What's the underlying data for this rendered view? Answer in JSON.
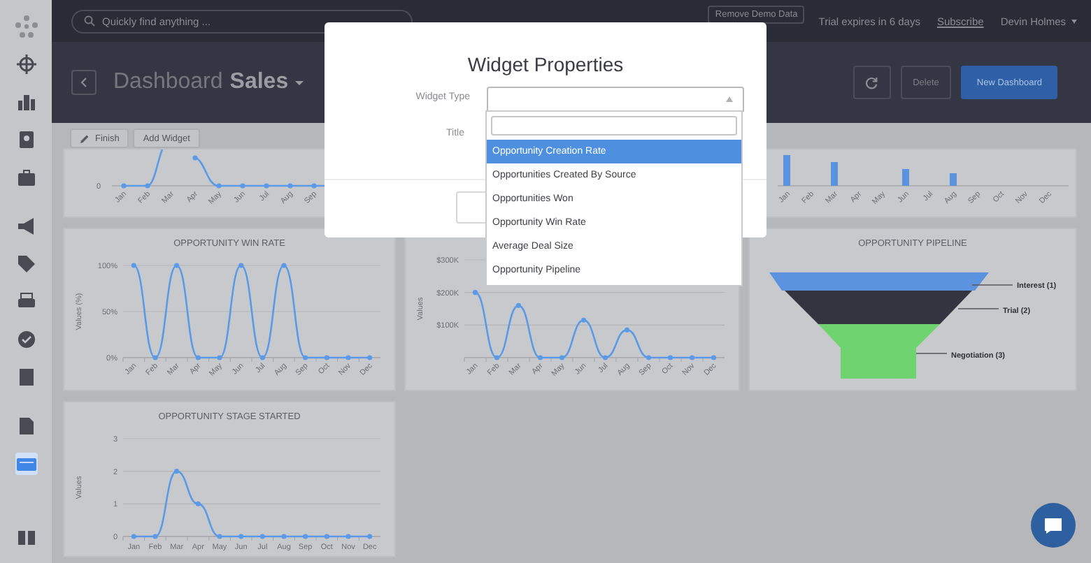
{
  "sidebar": {
    "items": [
      {
        "selected": false
      },
      {
        "selected": false
      },
      {
        "selected": false
      },
      {
        "selected": false
      },
      {
        "selected": false
      },
      {
        "selected": false
      },
      {
        "selected": false
      },
      {
        "selected": false
      },
      {
        "selected": false
      },
      {
        "selected": false
      },
      {
        "selected": true
      },
      {
        "selected": false
      }
    ]
  },
  "topbar": {
    "search": {
      "placeholder": "Quickly find anything ..."
    },
    "remove_demo": "Remove Demo Data",
    "trial": "Trial expires in 6 days",
    "subscribe": "Subscribe",
    "user": "Devin Holmes"
  },
  "header": {
    "title": "Dashboard",
    "dashboard": "Sales",
    "buttons": [
      "Delete",
      "New Dashboard"
    ]
  },
  "toolbar": {
    "finish": "Finish",
    "add_widget": "Add Widget"
  },
  "widgets_top": [
    {
      "kind": "line",
      "y_tick": "0",
      "x_labels": [
        "Jan",
        "Feb",
        "Mar",
        "Apr",
        "May",
        "Jun",
        "Jul",
        "Aug",
        "Sep"
      ]
    },
    {
      "kind": "bar",
      "x_labels": [
        "Jan",
        "Feb",
        "Mar",
        "Apr",
        "May",
        "Jun",
        "Jul",
        "Aug",
        "Sep",
        "Oct",
        "Nov",
        "Dec"
      ]
    }
  ],
  "win_rate": {
    "chart_data": {
      "type": "line",
      "title": "OPPORTUNITY WIN RATE",
      "ylabel": "Values (%)",
      "categories": [
        "Jan",
        "Feb",
        "Mar",
        "Apr",
        "May",
        "Jun",
        "Jul",
        "Aug",
        "Sep",
        "Oct",
        "Nov",
        "Dec"
      ],
      "series": [
        {
          "color": "#5b9ae6",
          "marker": true,
          "values": [
            100,
            0,
            100,
            0,
            0,
            100,
            0,
            100,
            0,
            0,
            0,
            0
          ]
        }
      ],
      "ylim": [
        0,
        100
      ],
      "yticks": [
        {
          "value": 0,
          "label": "0%"
        },
        {
          "value": 50,
          "label": "50%"
        },
        {
          "value": 100,
          "label": "100%"
        }
      ]
    }
  },
  "deal_size": {
    "chart_data": {
      "type": "line",
      "ylabel": "Values",
      "categories": [
        "Jan",
        "Feb",
        "Mar",
        "Apr",
        "May",
        "Jun",
        "Jul",
        "Aug",
        "Sep",
        "Oct",
        "Nov",
        "Dec"
      ],
      "series": [
        {
          "color": "#5b9ae6",
          "marker": true,
          "values": [
            200000,
            0,
            160000,
            0,
            0,
            115000,
            0,
            85000,
            0,
            0,
            0,
            0
          ]
        }
      ],
      "ylim": [
        0,
        300000
      ],
      "yticks": [
        {
          "value": 100000,
          "label": "$100K"
        },
        {
          "value": 200000,
          "label": "$200K"
        },
        {
          "value": 300000,
          "label": "$300K"
        }
      ]
    }
  },
  "pipeline": {
    "title": "OPPORTUNITY PIPELINE",
    "stages": [
      {
        "label": "Interest (1)",
        "color": "#5b93de"
      },
      {
        "label": "Trial (2)",
        "color": "#33343f"
      },
      {
        "label": "Negotiation (3)",
        "color": "#6fd46f"
      }
    ]
  },
  "stage_started": {
    "chart_data": {
      "type": "line",
      "title": "OPPORTUNITY STAGE STARTED",
      "ylabel": "Values",
      "categories": [
        "Jan",
        "Feb",
        "Mar",
        "Apr",
        "May",
        "Jun",
        "Jul",
        "Aug",
        "Sep",
        "Oct",
        "Nov",
        "Dec"
      ],
      "series": [
        {
          "color": "#5b9ae6",
          "marker": true,
          "values": [
            0,
            0,
            2,
            1,
            0,
            0,
            0,
            0,
            0,
            0,
            0,
            0
          ]
        }
      ],
      "ylim": [
        0,
        3
      ],
      "yticks": [
        0,
        1,
        2,
        3
      ]
    }
  },
  "modal": {
    "title": "Widget Properties",
    "widget_type_label": "Widget Type",
    "title_label": "Title",
    "options": [
      {
        "label": "Opportunity Creation Rate",
        "selected": true
      },
      {
        "label": "Opportunities Created By Source",
        "selected": false
      },
      {
        "label": "Opportunities Won",
        "selected": false
      },
      {
        "label": "Opportunity Win Rate",
        "selected": false
      },
      {
        "label": "Average Deal Size",
        "selected": false
      },
      {
        "label": "Opportunity Pipeline",
        "selected": false
      }
    ]
  }
}
